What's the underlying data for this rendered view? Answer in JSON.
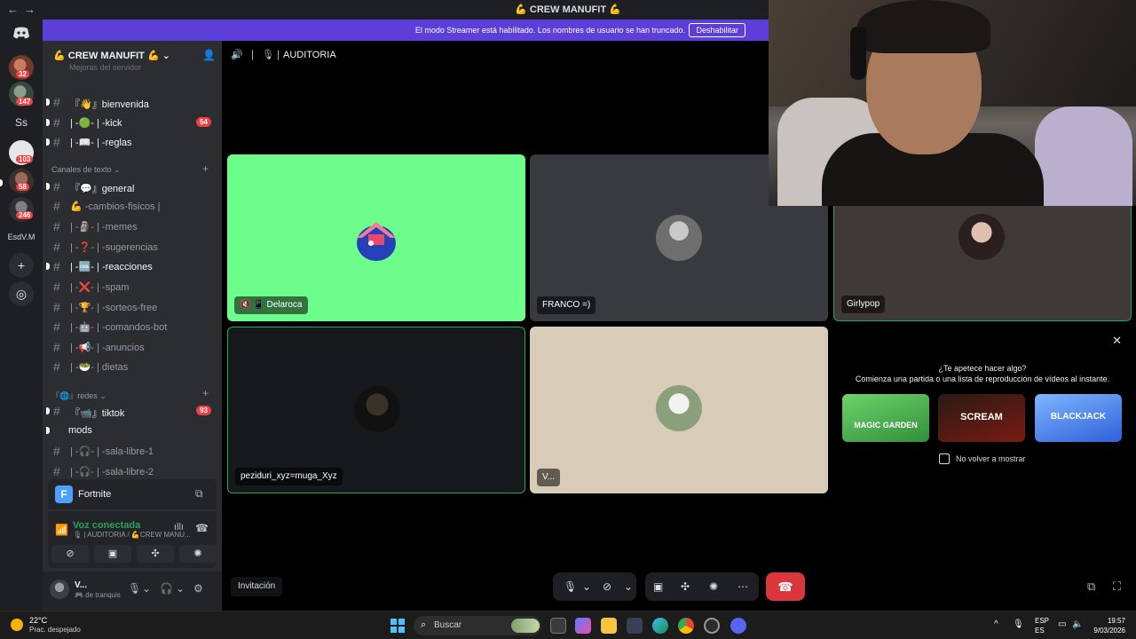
{
  "window": {
    "title": "💪 CREW MANUFIT 💪"
  },
  "banner": {
    "text": "El modo Streamer está habilitado. Los nombres de usuario se han truncado.",
    "button": "Deshabilitar"
  },
  "guilds": [
    {
      "badge": "32"
    },
    {
      "badge": "147"
    },
    {
      "label": "Ss"
    },
    {
      "badge": "103"
    },
    {
      "badge": "58"
    },
    {
      "badge": "246"
    },
    {
      "label": "EsdV.M"
    }
  ],
  "server": {
    "name": "💪 CREW MANUFIT 💪",
    "cut_text": "Mejoras del servidor",
    "categories": {
      "text": "Canales de texto",
      "redes": "『🌐』redes"
    },
    "channels": [
      {
        "name": "『👋』bienvenida",
        "badge": ""
      },
      {
        "name": "| -🟢- | -kick",
        "badge": "54"
      },
      {
        "name": "| -📖- | -reglas",
        "badge": ""
      },
      {
        "name": "『💬』general",
        "badge": ""
      },
      {
        "name": "💪 -cambios-fisicos |",
        "badge": ""
      },
      {
        "name": "| -🗿- | -memes",
        "badge": ""
      },
      {
        "name": "| -❓- | -sugerencias",
        "badge": ""
      },
      {
        "name": "| -🆒- | -reacciones",
        "badge": ""
      },
      {
        "name": "| -❌- | -spam",
        "badge": ""
      },
      {
        "name": "| -🏆- | -sorteos-free",
        "badge": ""
      },
      {
        "name": "| -🤖- | -comandos-bot",
        "badge": ""
      },
      {
        "name": "| -📢- | -anuncios",
        "badge": ""
      },
      {
        "name": "| -🥗- | dietas",
        "badge": ""
      },
      {
        "name": "『📹』tiktok",
        "badge": "93"
      },
      {
        "name": "mods",
        "badge": ""
      },
      {
        "name": "| -🎧- | -sala-libre-1",
        "badge": ""
      },
      {
        "name": "| -🎧- | -sala-libre-2",
        "badge": ""
      }
    ]
  },
  "activity": {
    "name": "Fortnite",
    "letter": "F"
  },
  "voice": {
    "status": "Voz conectada",
    "path": "🎙 | AUDITORIA / 💪CREW MANU..."
  },
  "user": {
    "name": "V...",
    "status": "🎮 de tranquis"
  },
  "call": {
    "channel": "AUDITORIA",
    "tiles": [
      {
        "label": "Delaroca"
      },
      {
        "label": "FRANCO =)"
      },
      {
        "label": "Girlypop"
      },
      {
        "label": "peziduri_xyz=muga_Xyz"
      },
      {
        "label": "V..."
      }
    ],
    "invite": "Invitación"
  },
  "activities": {
    "question": "¿Te apetece hacer algo?",
    "subtitle": "Comienza una partida o una lista de reproducción de vídeos al instante.",
    "games": [
      "MAGIC GARDEN",
      "SCREAM",
      "BLACKJACK"
    ],
    "checkbox_label": "No volver a mostrar"
  },
  "taskbar": {
    "temp": "22°C",
    "condition": "Prac. despejado",
    "search": "Buscar",
    "lang1": "ESP",
    "lang2": "ES",
    "time": "19:57",
    "date": "9/03/2026"
  },
  "colors": {
    "banner": "#5b3fd8",
    "tile_green": "#6dfd8a",
    "hangup": "#da373c",
    "speaking_border": "#23a55a"
  }
}
